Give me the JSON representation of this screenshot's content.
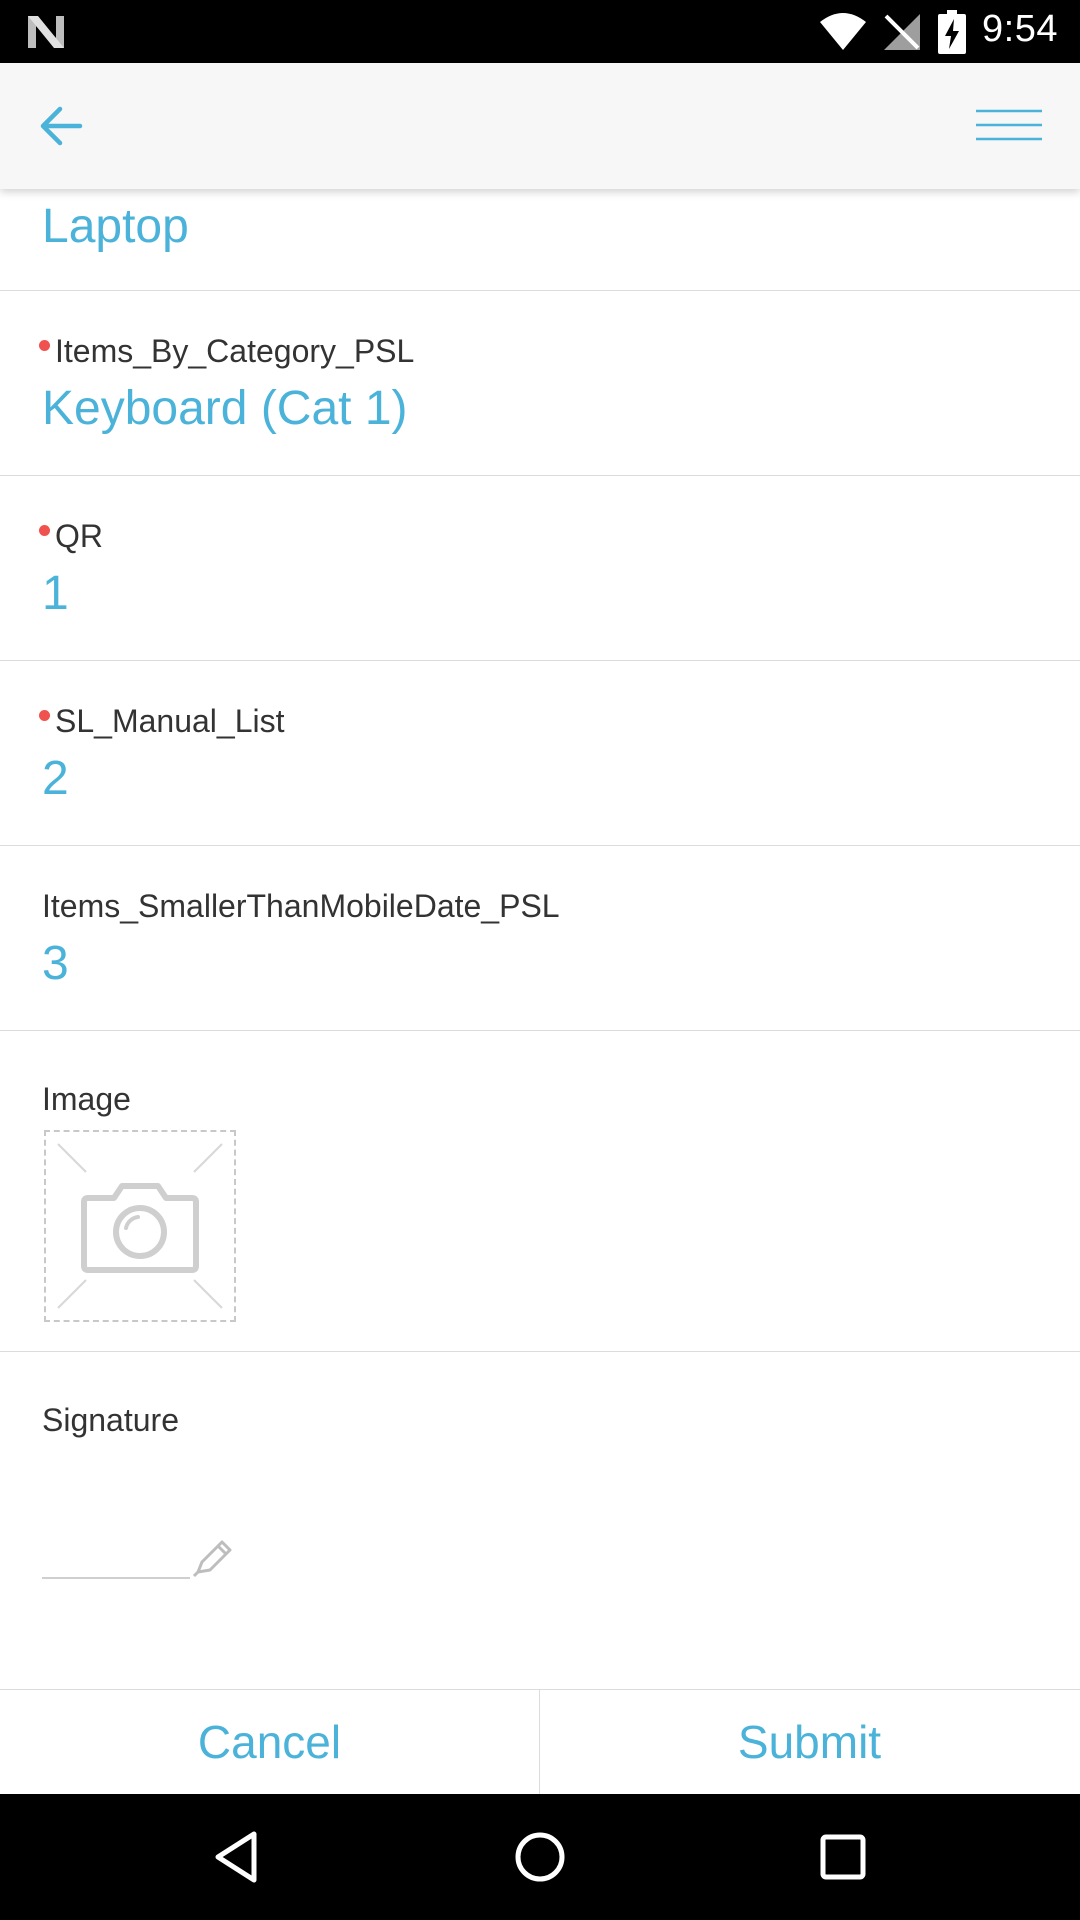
{
  "status_bar": {
    "time": "9:54",
    "icons": [
      "notification-n-icon",
      "wifi-icon",
      "no-signal-icon",
      "battery-charging-icon"
    ]
  },
  "toolbar": {
    "back_icon": "arrow-left-icon",
    "menu_icon": "hamburger-menu-icon"
  },
  "form": {
    "fields": [
      {
        "label": "",
        "value": "Laptop",
        "required": false
      },
      {
        "label": "Items_By_Category_PSL",
        "value": "Keyboard (Cat 1)",
        "required": true
      },
      {
        "label": "QR",
        "value": "1",
        "required": true
      },
      {
        "label": "SL_Manual_List",
        "value": "2",
        "required": true
      },
      {
        "label": "Items_SmallerThanMobileDate_PSL",
        "value": "3",
        "required": false
      }
    ],
    "image": {
      "label": "Image",
      "icon": "camera-icon"
    },
    "signature": {
      "label": "Signature",
      "icon": "pencil-icon"
    }
  },
  "actions": {
    "cancel_label": "Cancel",
    "submit_label": "Submit"
  },
  "colors": {
    "accent": "#4bb3d9",
    "required_dot": "#f0524f",
    "toolbar_bg": "#f7f7f7",
    "divider": "#dcdcdc"
  },
  "nav_bar": {
    "icons": [
      "back-triangle-icon",
      "home-circle-icon",
      "recents-square-icon"
    ]
  }
}
